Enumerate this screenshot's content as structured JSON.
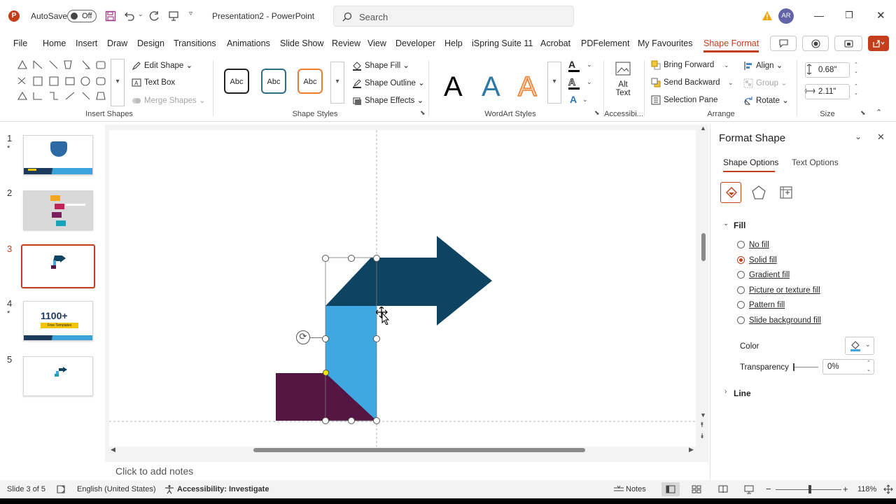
{
  "titlebar": {
    "autosave_label": "AutoSave",
    "autosave_state": "Off",
    "doc_title": "Presentation2 - PowerPoint",
    "search_placeholder": "Search",
    "user_initials": "AR"
  },
  "tabs": [
    "File",
    "Home",
    "Insert",
    "Draw",
    "Design",
    "Transitions",
    "Animations",
    "Slide Show",
    "Review",
    "View",
    "Developer",
    "Help",
    "iSpring Suite 11",
    "Acrobat",
    "PDFelement",
    "My Favourites",
    "Shape Format"
  ],
  "active_tab": "Shape Format",
  "ribbon": {
    "insert_shapes": {
      "label": "Insert Shapes",
      "edit_shape": "Edit Shape",
      "text_box": "Text Box",
      "merge_shapes": "Merge Shapes"
    },
    "shape_styles": {
      "label": "Shape Styles",
      "sample": "Abc",
      "shape_fill": "Shape Fill",
      "shape_outline": "Shape Outline",
      "shape_effects": "Shape Effects"
    },
    "wordart": {
      "label": "WordArt Styles",
      "letter": "A"
    },
    "accessibility": {
      "label": "Accessibi...",
      "alt_text_1": "Alt",
      "alt_text_2": "Text"
    },
    "arrange": {
      "label": "Arrange",
      "bring_forward": "Bring Forward",
      "send_backward": "Send Backward",
      "selection_pane": "Selection Pane",
      "align": "Align",
      "group": "Group",
      "rotate": "Rotate"
    },
    "size": {
      "label": "Size",
      "height": "0.68\"",
      "width": "2.11\""
    }
  },
  "slides": [
    {
      "num": "1",
      "star": "*"
    },
    {
      "num": "2",
      "star": ""
    },
    {
      "num": "3",
      "star": ""
    },
    {
      "num": "4",
      "star": "*"
    },
    {
      "num": "5",
      "star": ""
    }
  ],
  "thumb4_text_1": "1100+",
  "thumb4_text_2": "Free Templates",
  "notes_placeholder": "Click to add notes",
  "status": {
    "slide": "Slide 3 of 5",
    "language": "English (United States)",
    "accessibility": "Accessibility: Investigate",
    "notes": "Notes",
    "zoom": "118%"
  },
  "format_pane": {
    "title": "Format Shape",
    "tab_shape": "Shape Options",
    "tab_text": "Text Options",
    "fill_header": "Fill",
    "fill_options": [
      "No fill",
      "Solid fill",
      "Gradient fill",
      "Picture or texture fill",
      "Pattern fill",
      "Slide background fill"
    ],
    "selected_fill": "Solid fill",
    "color_label": "Color",
    "transparency_label": "Transparency",
    "transparency_value": "0%",
    "line_header": "Line"
  },
  "colors": {
    "accent": "#c43e1c",
    "arrow_dark": "#0e4461",
    "light_blue": "#40a8e0",
    "plum": "#561644"
  }
}
